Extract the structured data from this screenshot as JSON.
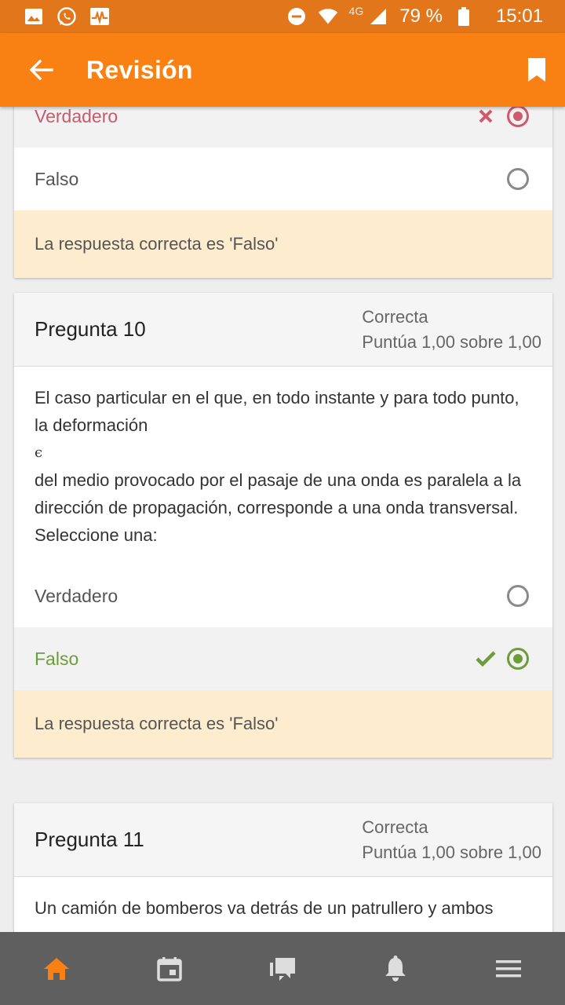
{
  "statusbar": {
    "network": "4G",
    "battery": "79 %",
    "time": "15:01"
  },
  "appbar": {
    "title": "Revisión"
  },
  "question9": {
    "options": [
      {
        "label": "Verdadero",
        "state": "selected-incorrect"
      },
      {
        "label": "Falso",
        "state": "unselected"
      }
    ],
    "feedback": "La respuesta correcta es 'Falso'"
  },
  "question10": {
    "title": "Pregunta 10",
    "status": "Correcta",
    "score": "Puntúa 1,00 sobre 1,00",
    "text_line1": "El caso particular en el que, en todo instante y para todo punto,",
    "text_line2": "la deformación",
    "symbol": "ϵ",
    "text_line3": "del medio provocado por el pasaje de una onda es paralela a la dirección de propagación, corresponde a una onda transversal. Seleccione una:",
    "options": [
      {
        "label": "Verdadero",
        "state": "unselected"
      },
      {
        "label": "Falso",
        "state": "selected-correct"
      }
    ],
    "feedback": "La respuesta correcta es 'Falso'"
  },
  "question11": {
    "title": "Pregunta 11",
    "status": "Correcta",
    "score": "Puntúa 1,00 sobre 1,00",
    "text": "Un camión de bomberos va detrás de un patrullero y ambos"
  },
  "colors": {
    "statusbar": "#e2761b",
    "appbar": "#f98012",
    "incorrect": "#d0596c",
    "correct": "#6c9d3a",
    "feedback_bg": "#fdedce",
    "bottomnav": "#5f5f5f",
    "active_nav": "#f98012"
  },
  "bottomnav": {
    "items": [
      "home-icon",
      "calendar-icon",
      "messages-icon",
      "notifications-icon",
      "menu-icon"
    ],
    "active": "home-icon"
  }
}
